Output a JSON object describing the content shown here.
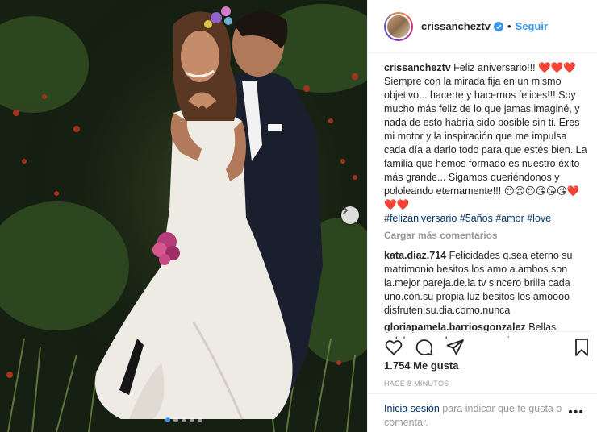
{
  "post": {
    "username": "crissancheztv",
    "separator": "•",
    "follow_label": "Seguir",
    "caption_text": "Feliz aniversario!!! ❤️❤️❤️ Siempre con la mirada fija en un mismo objetivo... hacerte y hacernos felices!!! Soy mucho más feliz de lo que jamas imaginé, y nada de esto habría sido posible sin ti. Eres mi motor y la inspiración que me impulsa cada día a darlo todo para que estés bien. La familia que hemos formado es nuestro éxito más grande... Sigamos queriéndonos y pololeando eternamente!!! 😍😍😍😘😘😘❤️❤️❤️",
    "hashtags": [
      "#felizaniversario",
      "#5años",
      "#amor",
      "#love"
    ],
    "load_more": "Cargar más comentarios",
    "comments": [
      {
        "user": "kata.diaz.714",
        "text": "Felicidades q.sea eterno su matrimonio besitos los amo a.ambos son la.mejor pareja.de.la tv sincero brilla cada uno.con.su propia luz besitos los amoooo disfruten.su.dia.como.nunca"
      },
      {
        "user": "gloriapamela.barriosgonzalez",
        "text": "Bellas palabras una hermosa pareja"
      }
    ],
    "likes": "1.754 Me gusta",
    "timestamp": "HACE 8 MINUTOS",
    "login_link": "Inicia sesión",
    "login_text": "para indicar que te gusta o comentar.",
    "more_glyph": "•••"
  },
  "carousel": {
    "slides": 5,
    "active_index": 0
  },
  "icons": {
    "like": "heart-outline-icon",
    "comment": "speech-bubble-icon",
    "share": "paper-plane-icon",
    "save": "bookmark-icon",
    "verified": "verified-badge-icon",
    "next": "chevron-right-icon"
  },
  "colors": {
    "link": "#003569",
    "follow": "#3897f0",
    "muted": "#999999",
    "heart": "#ed4956"
  }
}
